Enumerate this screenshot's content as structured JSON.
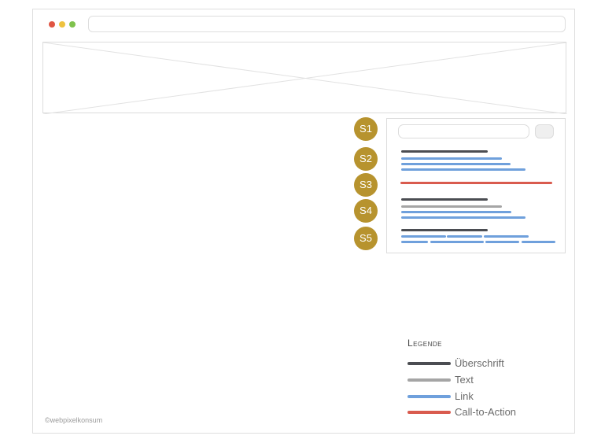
{
  "window": {
    "traffic_lights": [
      "#e05543",
      "#eec23f",
      "#7fc24d"
    ]
  },
  "colors": {
    "heading": "#4b4d52",
    "text": "#a5a5a5",
    "link": "#6fa0dc",
    "cta": "#d95b4e",
    "badge": "#b7932e"
  },
  "sections": [
    {
      "id": "s1",
      "label": "S1"
    },
    {
      "id": "s2",
      "label": "S2"
    },
    {
      "id": "s3",
      "label": "S3"
    },
    {
      "id": "s4",
      "label": "S4"
    },
    {
      "id": "s5",
      "label": "S5"
    }
  ],
  "legend": {
    "title": "Legende",
    "items": [
      {
        "label": "Überschrift",
        "color": "#4b4d52"
      },
      {
        "label": "Text",
        "color": "#a5a5a5"
      },
      {
        "label": "Link",
        "color": "#6fa0dc"
      },
      {
        "label": "Call-to-Action",
        "color": "#d95b4e"
      }
    ]
  },
  "footer": {
    "credit": "©webpixelkonsum"
  }
}
